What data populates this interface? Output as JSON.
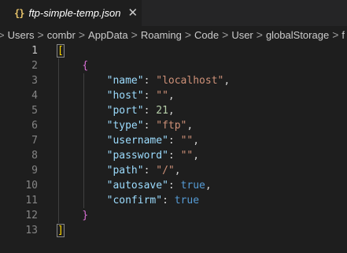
{
  "tab": {
    "icon_text": "{}",
    "filename": "ftp-simple-temp.json",
    "close_glyph": "✕"
  },
  "breadcrumb": {
    "items": [
      ">",
      "Users",
      "combr",
      "AppData",
      "Roaming",
      "Code",
      "User",
      "globalStorage",
      "f"
    ],
    "separator": ">"
  },
  "editor": {
    "line_numbers": [
      "1",
      "2",
      "3",
      "4",
      "5",
      "6",
      "7",
      "8",
      "9",
      "10",
      "11",
      "12",
      "13"
    ],
    "open_bracket": "[",
    "close_bracket": "]",
    "open_brace": "{",
    "close_brace": "}",
    "entries": [
      {
        "key": "\"name\"",
        "value": "\"localhost\"",
        "type": "str",
        "comma": ","
      },
      {
        "key": "\"host\"",
        "value": "\"\"",
        "type": "str",
        "comma": ","
      },
      {
        "key": "\"port\"",
        "value": "21",
        "type": "num",
        "comma": ","
      },
      {
        "key": "\"type\"",
        "value": "\"ftp\"",
        "type": "str",
        "comma": ","
      },
      {
        "key": "\"username\"",
        "value": "\"\"",
        "type": "str",
        "comma": ","
      },
      {
        "key": "\"password\"",
        "value": "\"\"",
        "type": "str",
        "comma": ","
      },
      {
        "key": "\"path\"",
        "value": "\"/\"",
        "type": "str",
        "comma": ","
      },
      {
        "key": "\"autosave\"",
        "value": "true",
        "type": "bool",
        "comma": ","
      },
      {
        "key": "\"confirm\"",
        "value": "true",
        "type": "bool",
        "comma": ""
      }
    ]
  },
  "colors": {
    "background": "#1e1e1e",
    "key": "#9cdcfe",
    "string": "#ce9178",
    "number": "#b5cea8",
    "boolean": "#569cd6",
    "bracket": "#ffd700",
    "brace": "#da70d6"
  }
}
